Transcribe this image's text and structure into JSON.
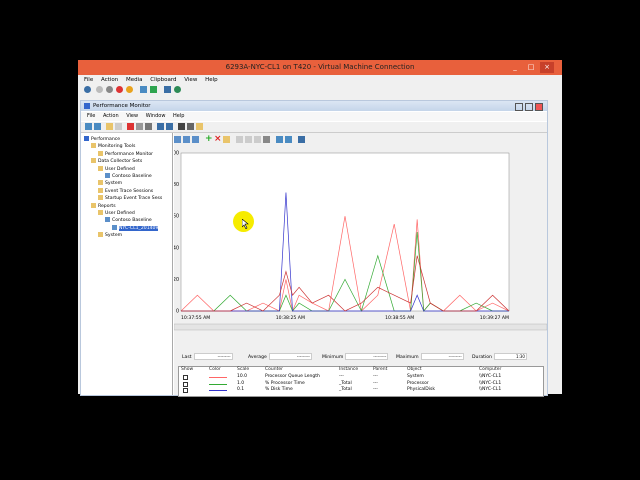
{
  "vm_window": {
    "title": "6293A-NYC-CL1 on T420 - Virtual Machine Connection",
    "menu": [
      "File",
      "Action",
      "Media",
      "Clipboard",
      "View",
      "Help"
    ]
  },
  "pm_window": {
    "title": "Performance Monitor",
    "menu": [
      "File",
      "Action",
      "View",
      "Window",
      "Help"
    ]
  },
  "tree": [
    {
      "label": "Performance",
      "level": 0
    },
    {
      "label": "Monitoring Tools",
      "level": 1
    },
    {
      "label": "Performance Monitor",
      "level": 2
    },
    {
      "label": "Data Collector Sets",
      "level": 1
    },
    {
      "label": "User Defined",
      "level": 2
    },
    {
      "label": "Contoso Baseline",
      "level": 3
    },
    {
      "label": "System",
      "level": 2
    },
    {
      "label": "Event Trace Sessions",
      "level": 2
    },
    {
      "label": "Startup Event Trace Sess",
      "level": 2
    },
    {
      "label": "Reports",
      "level": 1
    },
    {
      "label": "User Defined",
      "level": 2
    },
    {
      "label": "Contoso Baseline",
      "level": 3
    },
    {
      "label": "NYC-CL1_201409",
      "level": 4,
      "selected": true
    },
    {
      "label": "System",
      "level": 2
    }
  ],
  "chart_data": {
    "type": "line",
    "ylim": [
      0,
      100
    ],
    "y_ticks": [
      "100",
      "80",
      "60",
      "40",
      "20",
      "0"
    ],
    "x_tick_labels": [
      "10:37:55 AM",
      "10:38:25 AM",
      "10:38:55 AM",
      "10:39:27 AM"
    ],
    "x": [
      0,
      5,
      10,
      15,
      20,
      25,
      30,
      32,
      34,
      36,
      40,
      45,
      50,
      55,
      60,
      65,
      70,
      72,
      74,
      76,
      80,
      85,
      90,
      95,
      100
    ],
    "series": [
      {
        "color": "#ff6666",
        "values": [
          0,
          10,
          0,
          0,
          0,
          5,
          0,
          20,
          0,
          10,
          5,
          0,
          60,
          0,
          10,
          55,
          0,
          58,
          0,
          5,
          0,
          10,
          0,
          5,
          0
        ]
      },
      {
        "color": "#33aa33",
        "values": [
          0,
          0,
          0,
          10,
          0,
          0,
          0,
          10,
          0,
          5,
          0,
          0,
          20,
          0,
          35,
          0,
          0,
          50,
          0,
          5,
          0,
          0,
          5,
          0,
          0
        ]
      },
      {
        "color": "#3333cc",
        "values": [
          0,
          0,
          0,
          0,
          0,
          0,
          0,
          75,
          0,
          0,
          0,
          0,
          0,
          0,
          0,
          0,
          0,
          10,
          0,
          0,
          0,
          0,
          0,
          0,
          0
        ]
      },
      {
        "color": "#cc3333",
        "values": [
          0,
          0,
          0,
          0,
          5,
          0,
          10,
          25,
          10,
          15,
          5,
          10,
          0,
          5,
          15,
          10,
          5,
          35,
          20,
          5,
          0,
          0,
          0,
          10,
          0
        ]
      }
    ]
  },
  "stats": {
    "last": "Last",
    "last_v": "---------",
    "average": "Average",
    "average_v": "---------",
    "minimum": "Minimum",
    "minimum_v": "---------",
    "maximum": "Maximum",
    "maximum_v": "---------",
    "duration": "Duration",
    "duration_v": "1:30"
  },
  "counter_table": {
    "headers": [
      "Show",
      "Color",
      "Scale",
      "Counter",
      "Instance",
      "Parent",
      "Object",
      "Computer"
    ],
    "rows": [
      {
        "scale": "10.0",
        "counter": "Processor Queue Length",
        "instance": "---",
        "parent": "---",
        "object": "System",
        "computer": "\\\\NYC-CL1",
        "color": "#ff6666"
      },
      {
        "scale": "1.0",
        "counter": "% Processor Time",
        "instance": "_Total",
        "parent": "---",
        "object": "Processor",
        "computer": "\\\\NYC-CL1",
        "color": "#33aa33"
      },
      {
        "scale": "0.1",
        "counter": "% Disk Time",
        "instance": "_Total",
        "parent": "---",
        "object": "PhysicalDisk",
        "computer": "\\\\NYC-CL1",
        "color": "#3333cc"
      }
    ]
  }
}
